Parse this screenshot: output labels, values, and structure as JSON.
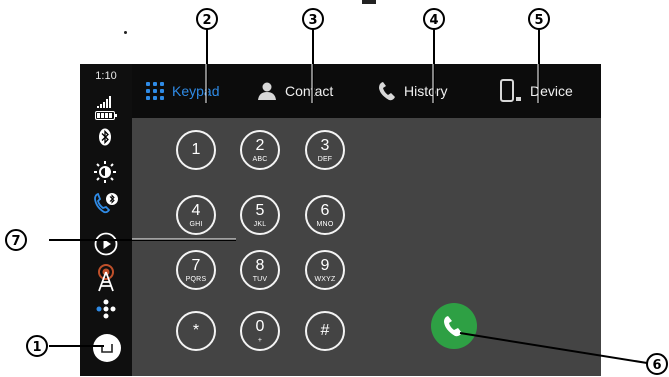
{
  "status": {
    "time": "1:10"
  },
  "tabs": [
    {
      "label": "Keypad",
      "icon": "keypad-grid-icon",
      "active": true
    },
    {
      "label": "Contact",
      "icon": "person-icon",
      "active": false
    },
    {
      "label": "History",
      "icon": "phone-handset-icon",
      "active": false
    },
    {
      "label": "Device",
      "icon": "smartphone-icon",
      "active": false
    }
  ],
  "keypad": [
    {
      "digit": "1",
      "letters": ""
    },
    {
      "digit": "2",
      "letters": "ABC"
    },
    {
      "digit": "3",
      "letters": "DEF"
    },
    {
      "digit": "4",
      "letters": "GHI"
    },
    {
      "digit": "5",
      "letters": "JKL"
    },
    {
      "digit": "6",
      "letters": "MNO"
    },
    {
      "digit": "7",
      "letters": "PQRS"
    },
    {
      "digit": "8",
      "letters": "TUV"
    },
    {
      "digit": "9",
      "letters": "WXYZ"
    },
    {
      "digit": "*",
      "letters": ""
    },
    {
      "digit": "0",
      "letters": "+"
    },
    {
      "digit": "#",
      "letters": ""
    }
  ],
  "callouts": [
    "1",
    "2",
    "3",
    "4",
    "5",
    "6",
    "7"
  ],
  "colors": {
    "accent": "#2f8be6",
    "call": "#2ea044",
    "panel": "#444444",
    "bar": "#0c0c0c"
  }
}
